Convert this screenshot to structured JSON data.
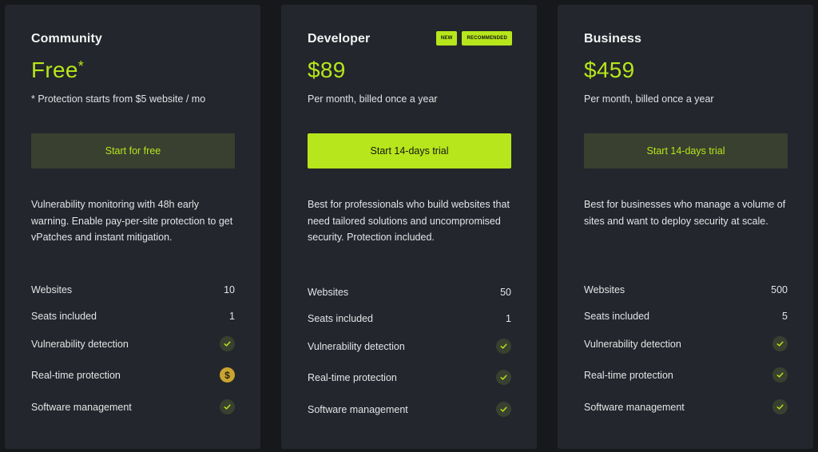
{
  "colors": {
    "accent": "#b6e61b",
    "card": "#23262c",
    "background": "#17181b",
    "dollar": "#c9a430"
  },
  "plans": [
    {
      "name": "Community",
      "price": "Free",
      "price_mark": "*",
      "subtitle": "* Protection starts from $5 website / mo",
      "button": "Start for free",
      "description": "Vulnerability monitoring with 48h early warning. Enable pay-per-site protection to get vPatches and instant mitigation.",
      "features": {
        "websites_label": "Websites",
        "websites": "10",
        "seats_label": "Seats included",
        "seats": "1",
        "vuln_label": "Vulnerability detection",
        "vuln_icon": "check-icon",
        "rtp_label": "Real-time protection",
        "rtp_icon": "dollar-icon",
        "rtp_symbol": "$",
        "sw_label": "Software management",
        "sw_icon": "check-icon"
      }
    },
    {
      "name": "Developer",
      "badges": [
        "NEW",
        "RECOMMENDED"
      ],
      "price": "$89",
      "subtitle": "Per month, billed once a year",
      "button": "Start 14-days trial",
      "description": "Best for professionals who build websites that need tailored solutions and uncompromised security. Protection included.",
      "features": {
        "websites_label": "Websites",
        "websites": "50",
        "seats_label": "Seats included",
        "seats": "1",
        "vuln_label": "Vulnerability detection",
        "vuln_icon": "check-icon",
        "rtp_label": "Real-time protection",
        "rtp_icon": "check-icon",
        "sw_label": "Software management",
        "sw_icon": "check-icon"
      }
    },
    {
      "name": "Business",
      "price": "$459",
      "subtitle": "Per month, billed once a year",
      "button": "Start 14-days trial",
      "description": "Best for businesses who manage a volume of sites and want to deploy security at scale.",
      "features": {
        "websites_label": "Websites",
        "websites": "500",
        "seats_label": "Seats included",
        "seats": "5",
        "vuln_label": "Vulnerability detection",
        "vuln_icon": "check-icon",
        "rtp_label": "Real-time protection",
        "rtp_icon": "check-icon",
        "sw_label": "Software management",
        "sw_icon": "check-icon"
      }
    }
  ]
}
